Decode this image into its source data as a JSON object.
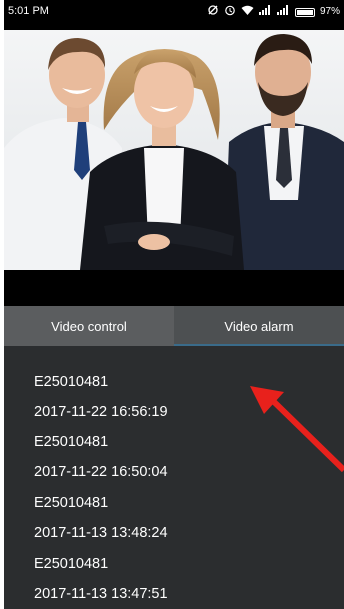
{
  "status_bar": {
    "time": "5:01 PM",
    "battery": "97%"
  },
  "tabs": [
    {
      "label": "Video control"
    },
    {
      "label": "Video alarm"
    }
  ],
  "alarm_list": [
    "E25010481",
    "2017-11-22 16:56:19",
    "E25010481",
    "2017-11-22 16:50:04",
    "E25010481",
    "2017-11-13 13:48:24",
    "E25010481",
    "2017-11-13 13:47:51"
  ],
  "colors": {
    "tab_bar": "#5b5d5f",
    "list_bg": "#2b2d2f",
    "arrow": "#e8211c"
  },
  "icons": [
    "no-sim-icon",
    "alarm-clock-icon",
    "wifi-icon",
    "signal-icon",
    "signal-icon",
    "battery-icon"
  ]
}
